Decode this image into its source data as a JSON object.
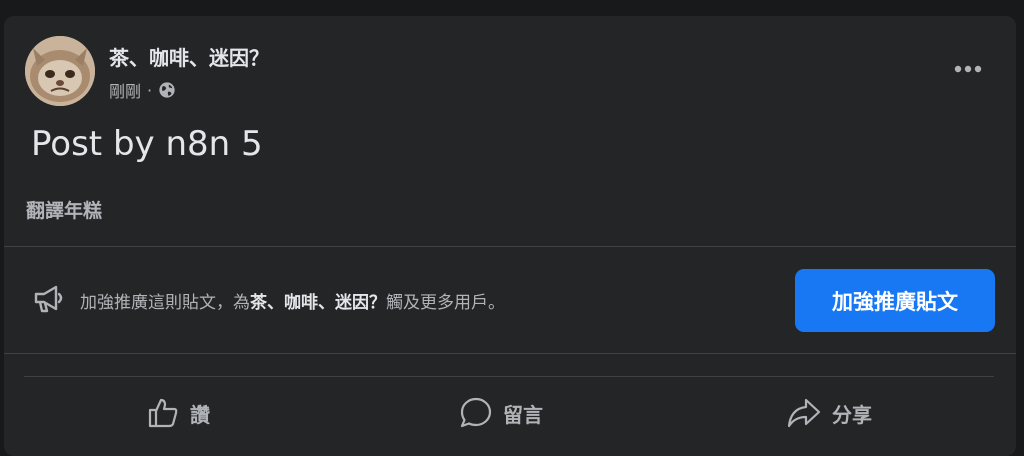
{
  "post": {
    "author": "茶、咖啡、迷因？",
    "time": "剛剛",
    "separator": "·",
    "privacy_icon": "globe-icon",
    "more_icon": "more-dots-icon",
    "text": "Post by n8n 5",
    "translate_label": "翻譯年糕"
  },
  "boost": {
    "icon": "megaphone-icon",
    "text_prefix": "加強推廣這則貼文，為",
    "page_name": "茶、咖啡、迷因？",
    "text_suffix": "觸及更多用戶。",
    "button_label": "加強推廣貼文"
  },
  "actions": [
    {
      "label": "讚",
      "icon": "like-icon"
    },
    {
      "label": "留言",
      "icon": "comment-icon"
    },
    {
      "label": "分享",
      "icon": "share-icon"
    }
  ],
  "colors": {
    "background": "#18191a",
    "card": "#242526",
    "primary_text": "#e4e6eb",
    "secondary_text": "#b0b3b8",
    "accent": "#1877f2",
    "divider": "#3e4042"
  }
}
